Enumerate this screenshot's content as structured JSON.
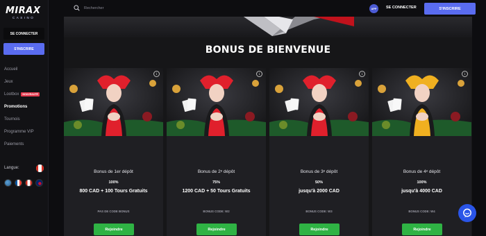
{
  "brand": {
    "name": "MIRAX",
    "tagline": "CASINO"
  },
  "sidebar": {
    "login_label": "SE CONNECTER",
    "signup_label": "S'INSCRIRE",
    "items": [
      {
        "label": "Accueil"
      },
      {
        "label": "Jeux"
      },
      {
        "label": "Lootbox",
        "badge": "NOUVEAUTÉ"
      },
      {
        "label": "Promotions",
        "active": true
      },
      {
        "label": "Tournois"
      },
      {
        "label": "Programme VIP"
      },
      {
        "label": "Paiements"
      }
    ],
    "language_label": "Langue:"
  },
  "topbar": {
    "search_placeholder": "Rechercher",
    "app_badge": "APP",
    "login_label": "SE CONNECTER",
    "signup_label": "S'INSCRIRE"
  },
  "main": {
    "section_title": "BONUS DE BIENVENUE",
    "cards": [
      {
        "title": "Bonus de 1er dépôt",
        "percent": "100%",
        "offer": "800 CAD + 100 Tours Gratuits",
        "code": "PAS DE CODE BONUS",
        "button": "Rejoindre",
        "costume": "#e0202c"
      },
      {
        "title": "Bonus de 2ᵉ dépôt",
        "percent": "75%",
        "offer": "1200 CAD + 50 Tours Gratuits",
        "code": "BONUS CODE: W2",
        "button": "Rejoindre",
        "costume": "#e0202c"
      },
      {
        "title": "Bonus de 3ᵉ dépôt",
        "percent": "50%",
        "offer": "jusqu'à 2000 CAD",
        "code": "BONUS CODE: W3",
        "button": "Rejoindre",
        "costume": "#e0202c"
      },
      {
        "title": "Bonus de 4ᵉ dépôt",
        "percent": "100%",
        "offer": "jusqu'à 4000 CAD",
        "code": "BONUS CODE: W4",
        "button": "Rejoindre",
        "costume": "#f0b020"
      }
    ]
  },
  "colors": {
    "accent": "#5a6cf0",
    "join_button": "#2fb344",
    "badge_new": "#e53a4f",
    "chat": "#2a55e8"
  },
  "icons": {
    "search": "search-icon",
    "info": "info-icon",
    "chat": "chat-icon"
  }
}
